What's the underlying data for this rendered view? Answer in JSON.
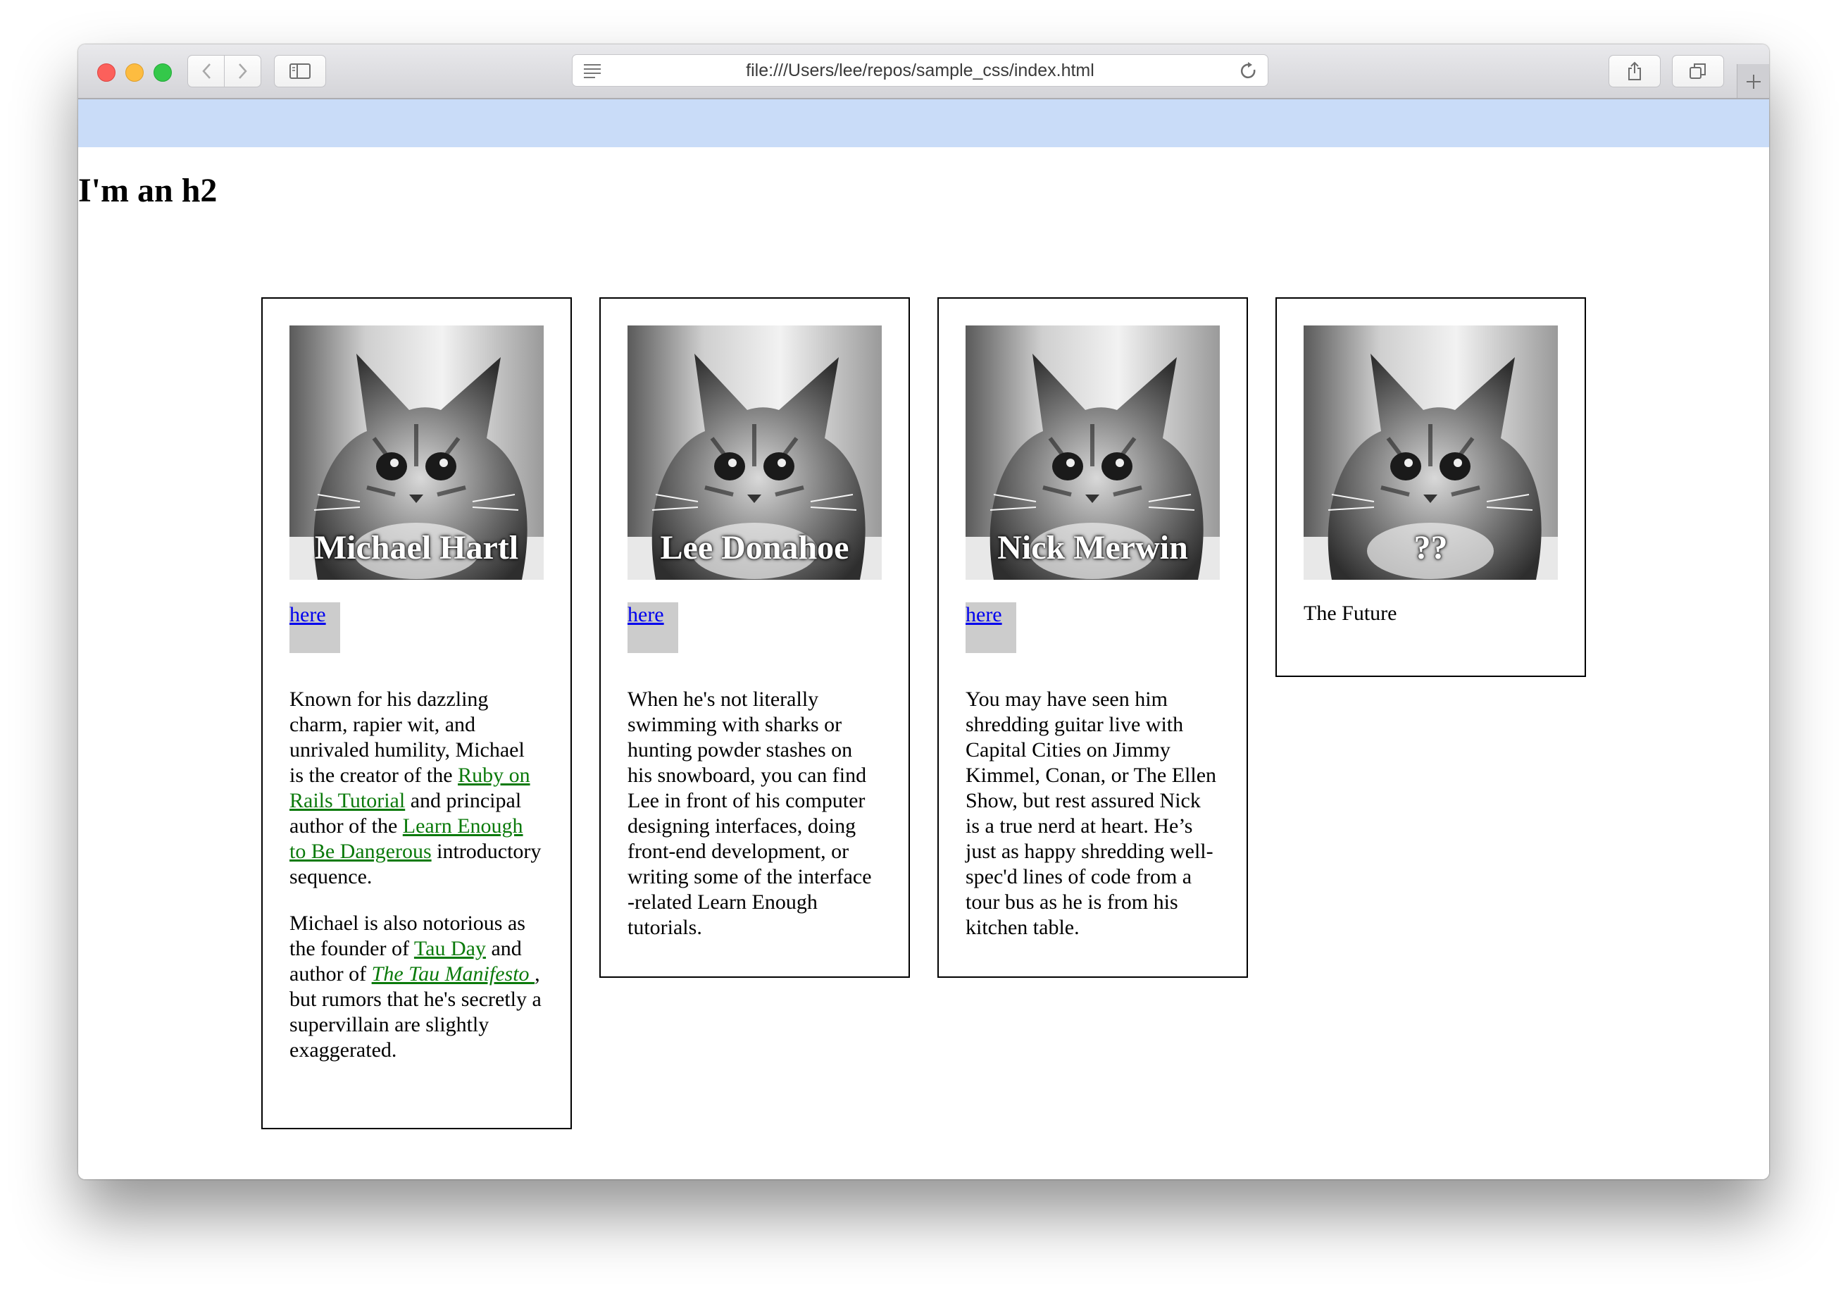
{
  "browser": {
    "url": "file:///Users/lee/repos/sample_css/index.html"
  },
  "page": {
    "heading": "I'm an h2"
  },
  "cards": [
    {
      "name": "Michael Hartl",
      "link_label": "here",
      "paragraphs": [
        {
          "t1": "Known for his dazzling charm, rapier wit, and unrivaled humility, Michael is the creator of the ",
          "l1": "Ruby on Rails Tutorial",
          "t2": " and principal author of the ",
          "l2": "Learn Enough to Be Dangerous",
          "t3": " introductory sequence."
        },
        {
          "t1": "Michael is also notorious as the founder of ",
          "l1": "Tau Day",
          "t2": " and author of ",
          "l2": "The Tau Manifesto ",
          "t3": ", but rumors that he's secretly a supervillain are slightly exaggerated."
        }
      ]
    },
    {
      "name": "Lee Donahoe",
      "link_label": "here",
      "text": "When he's not literally swimming with sharks or hunting powder stashes on his snowboard, you can find Lee in front of his computer designing interfaces, doing front-end development, or writing some of the interface -related Learn Enough tutorials."
    },
    {
      "name": "Nick Merwin",
      "link_label": "here",
      "text": "You may have seen him shredding guitar live with Capital Cities on Jimmy Kimmel, Conan, or The Ellen Show, but rest assured Nick is a true nerd at heart. He’s just as happy shredding well-spec'd lines of code from a tour bus as he is from his kitchen table."
    },
    {
      "name": "??",
      "text": "The Future"
    }
  ],
  "colors": {
    "top_band": "#c9dcf8",
    "link_blue": "#0000ee",
    "link_green": "#0b7a0b",
    "link_box": "#cccccc"
  },
  "icons": {
    "back": "chevron-left-icon",
    "forward": "chevron-right-icon",
    "sidebar": "sidebar-icon",
    "reader": "reader-icon",
    "reload": "reload-icon",
    "share": "share-icon",
    "tabs": "tabs-icon",
    "new_tab": "plus-icon",
    "card_image": "kitten-photo"
  }
}
